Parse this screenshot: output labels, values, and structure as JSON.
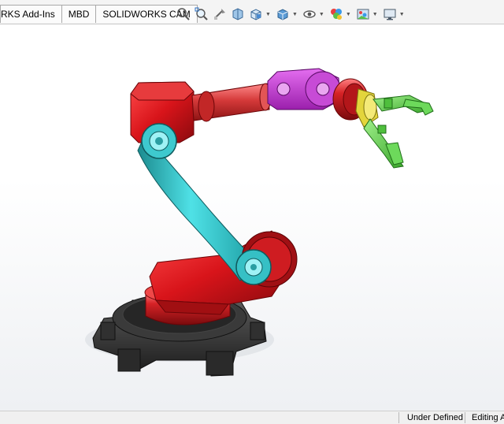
{
  "tabs": [
    {
      "label": "RKS Add-Ins"
    },
    {
      "label": "MBD"
    },
    {
      "label": "SOLIDWORKS CAM"
    }
  ],
  "view_toolbar": {
    "icons": [
      "zoom-to-fit-icon",
      "zoom-to-area-icon",
      "previous-view-icon",
      "section-view-icon",
      "view-orientation-icon",
      "display-style-icon",
      "hide-show-items-icon",
      "edit-appearance-icon",
      "apply-scene-icon",
      "view-settings-icon"
    ]
  },
  "model": {
    "name": "robot-arm-assembly",
    "colors": {
      "base": "#2b2b2b",
      "turret": "#e0161b",
      "shoulder": "#d42424",
      "upper_arm": "#35c4c9",
      "forearm": "#d63a3a",
      "wrist": "#c93ad6",
      "wrist_flange": "#e23030",
      "tool_adapter": "#e3d53c",
      "gripper": "#5fd64a"
    }
  },
  "status": {
    "definition": "Under Defined",
    "mode": "Editing A"
  }
}
